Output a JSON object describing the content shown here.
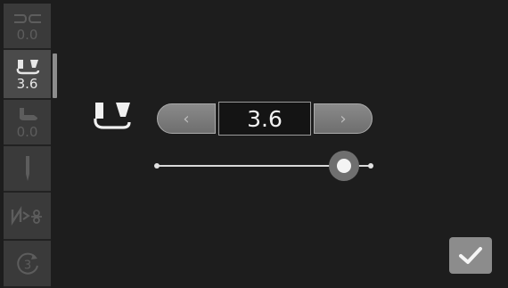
{
  "sidebar": {
    "items": [
      {
        "icon": "stitch-width-icon",
        "label": "0.0",
        "active": false
      },
      {
        "icon": "presser-foot-icon",
        "label": "3.6",
        "active": true
      },
      {
        "icon": "foot-pressure-icon",
        "label": "0.0",
        "active": false
      },
      {
        "icon": "needle-icon",
        "label": "",
        "active": false
      },
      {
        "icon": "thread-cutter-icon",
        "label": "",
        "active": false
      },
      {
        "icon": "program-3-icon",
        "label": "",
        "active": false
      }
    ]
  },
  "control": {
    "icon": "presser-foot-icon",
    "value": "3.6",
    "slider_fraction": 0.874
  },
  "ok": {
    "icon": "check-icon"
  }
}
